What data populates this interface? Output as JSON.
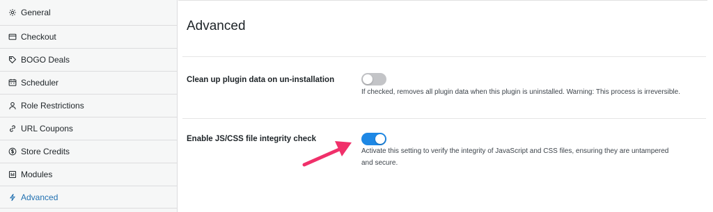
{
  "sidebar": {
    "items": [
      {
        "label": "General",
        "icon": "gear-icon"
      },
      {
        "label": "Checkout",
        "icon": "credit-card-icon"
      },
      {
        "label": "BOGO Deals",
        "icon": "tag-icon"
      },
      {
        "label": "Scheduler",
        "icon": "calendar-icon"
      },
      {
        "label": "Role Restrictions",
        "icon": "user-icon"
      },
      {
        "label": "URL Coupons",
        "icon": "link-icon"
      },
      {
        "label": "Store Credits",
        "icon": "dollar-coin-icon"
      },
      {
        "label": "Modules",
        "icon": "modules-icon"
      },
      {
        "label": "Advanced",
        "icon": "lightning-icon",
        "active": true
      }
    ]
  },
  "main": {
    "title": "Advanced",
    "settings": [
      {
        "label": "Clean up plugin data on un-installation",
        "enabled": false,
        "description": "If checked, removes all plugin data when this plugin is uninstalled. Warning: This process is irreversible."
      },
      {
        "label": "Enable JS/CSS file integrity check",
        "enabled": true,
        "description_line1": "Activate this setting to verify the integrity of JavaScript and CSS files, ensuring they are untampered",
        "description_line2": "and secure."
      }
    ]
  },
  "colors": {
    "accent": "#2271b1",
    "toggle_on": "#1e88e5",
    "toggle_off": "#c3c4c7",
    "arrow": "#f0306a"
  }
}
